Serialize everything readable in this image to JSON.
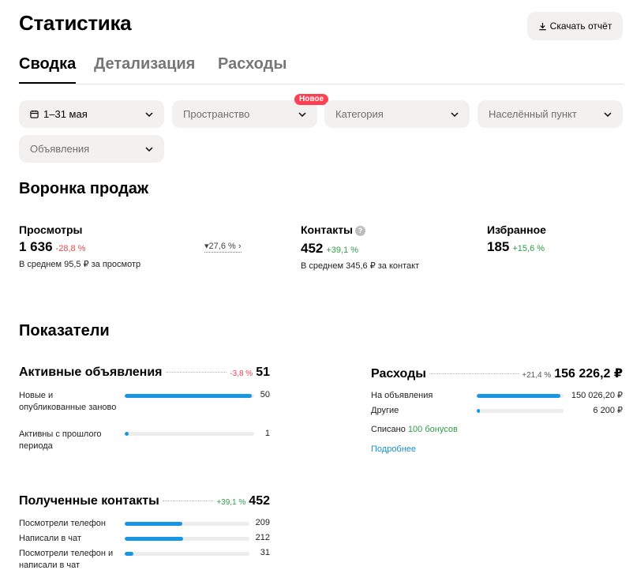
{
  "header": {
    "title": "Статистика",
    "download_label": "Скачать отчёт"
  },
  "tabs": [
    {
      "label": "Сводка",
      "active": true
    },
    {
      "label": "Детализация",
      "active": false
    },
    {
      "label": "Расходы",
      "active": false
    }
  ],
  "filters": {
    "period": "1–31 мая",
    "space": "Пространство",
    "space_badge": "Новое",
    "category": "Категория",
    "city": "Населённый пункт",
    "ads": "Объявления"
  },
  "funnel": {
    "title": "Воронка продаж",
    "views": {
      "label": "Просмотры",
      "value": "1 636",
      "delta": "-28,8 %",
      "sub": "В среднем 95,5 ₽ за просмотр",
      "conversion": "27,6 %"
    },
    "contacts": {
      "label": "Контакты",
      "value": "452",
      "delta": "+39,1 %",
      "sub": "В среднем 345,6 ₽ за контакт",
      "help": "?"
    },
    "favorites": {
      "label": "Избранное",
      "value": "185",
      "delta": "+15,6 %"
    }
  },
  "indicators": {
    "title": "Показатели",
    "active_ads": {
      "label": "Активные объявления",
      "delta": "-3,8 %",
      "total": "51",
      "rows": [
        {
          "label": "Новые и опубликованные заново",
          "value": "50",
          "fraction": 0.98
        },
        {
          "label": "Активны с прошлого периода",
          "value": "1",
          "fraction": 0.03
        }
      ]
    },
    "expenses": {
      "label": "Расходы",
      "delta": "+21,4 %",
      "total": "156 226,2 ₽",
      "rows": [
        {
          "label": "На объявления",
          "value": "150 026,20 ₽",
          "fraction": 0.96
        },
        {
          "label": "Другие",
          "value": "6 200 ₽",
          "fraction": 0.04
        }
      ],
      "written_off": "Списано",
      "bonus": "100 бонусов",
      "more": "Подробнее"
    },
    "contacts": {
      "label": "Полученные контакты",
      "delta": "+39,1 %",
      "total": "452",
      "rows": [
        {
          "label": "Посмотрели телефон",
          "value": "209",
          "fraction": 0.46
        },
        {
          "label": "Написали в чат",
          "value": "212",
          "fraction": 0.47
        },
        {
          "label": "Посмотрели телефон и написали в чат",
          "value": "31",
          "fraction": 0.07
        }
      ]
    }
  },
  "colors": {
    "accent_blue": "#1797e3",
    "negative": "#e8454f",
    "positive": "#2e9e45",
    "badge": "#ff4053",
    "chip_bg": "#f2f1f0"
  }
}
